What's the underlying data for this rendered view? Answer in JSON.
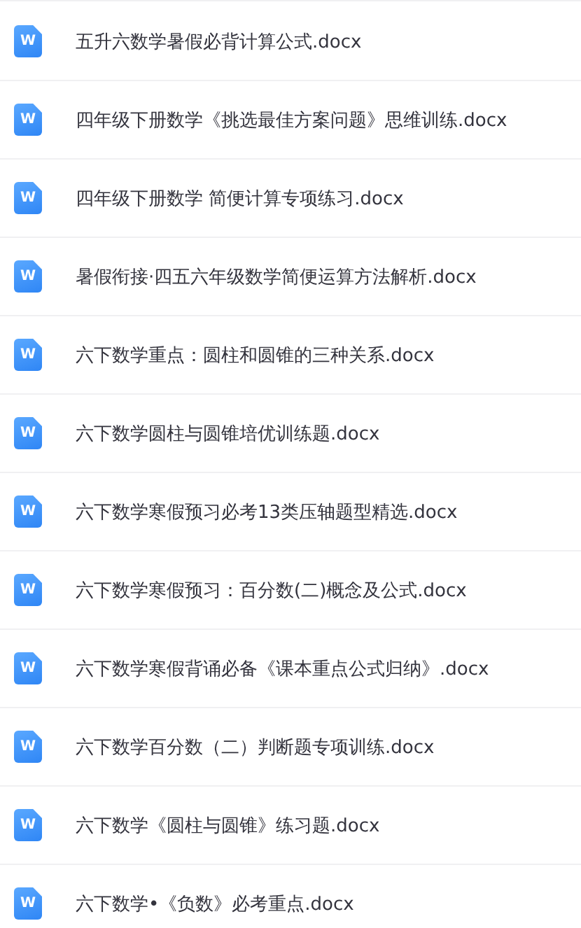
{
  "files": [
    {
      "icon_letter": "W",
      "name": "五升六数学暑假必背计算公式.docx"
    },
    {
      "icon_letter": "W",
      "name": "四年级下册数学《挑选最佳方案问题》思维训练.docx"
    },
    {
      "icon_letter": "W",
      "name": "四年级下册数学 简便计算专项练习.docx"
    },
    {
      "icon_letter": "W",
      "name": "暑假衔接·四五六年级数学简便运算方法解析.docx"
    },
    {
      "icon_letter": "W",
      "name": "六下数学重点：圆柱和圆锥的三种关系.docx"
    },
    {
      "icon_letter": "W",
      "name": "六下数学圆柱与圆锥培优训练题.docx"
    },
    {
      "icon_letter": "W",
      "name": "六下数学寒假预习必考13类压轴题型精选.docx"
    },
    {
      "icon_letter": "W",
      "name": "六下数学寒假预习：百分数(二)概念及公式.docx"
    },
    {
      "icon_letter": "W",
      "name": "六下数学寒假背诵必备《课本重点公式归纳》.docx"
    },
    {
      "icon_letter": "W",
      "name": "六下数学百分数（二）判断题专项训练.docx"
    },
    {
      "icon_letter": "W",
      "name": "六下数学《圆柱与圆锥》练习题.docx"
    },
    {
      "icon_letter": "W",
      "name": "六下数学•《负数》必考重点.docx"
    }
  ]
}
